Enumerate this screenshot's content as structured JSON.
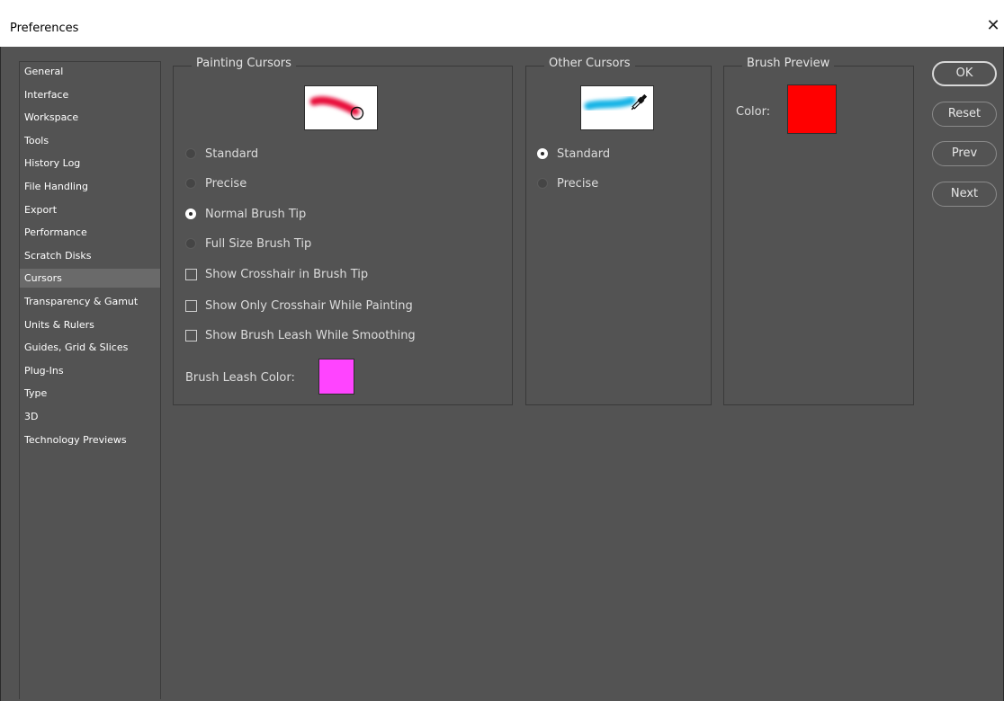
{
  "window": {
    "title": "Preferences",
    "close_glyph": "✕"
  },
  "sidebar": {
    "items": [
      {
        "label": "General"
      },
      {
        "label": "Interface"
      },
      {
        "label": "Workspace"
      },
      {
        "label": "Tools"
      },
      {
        "label": "History Log"
      },
      {
        "label": "File Handling"
      },
      {
        "label": "Export"
      },
      {
        "label": "Performance"
      },
      {
        "label": "Scratch Disks"
      },
      {
        "label": "Cursors",
        "selected": true
      },
      {
        "label": "Transparency & Gamut"
      },
      {
        "label": "Units & Rulers"
      },
      {
        "label": "Guides, Grid & Slices"
      },
      {
        "label": "Plug-Ins"
      },
      {
        "label": "Type"
      },
      {
        "label": "3D"
      },
      {
        "label": "Technology Previews"
      }
    ]
  },
  "painting_cursors": {
    "title": "Painting Cursors",
    "preview_icon": "brush-stroke-circle-cursor-icon",
    "stroke_color": "#e8103a",
    "options": [
      {
        "label": "Standard",
        "selected": false
      },
      {
        "label": "Precise",
        "selected": false
      },
      {
        "label": "Normal Brush Tip",
        "selected": true
      },
      {
        "label": "Full Size Brush Tip",
        "selected": false
      }
    ],
    "checkboxes": [
      {
        "label": "Show Crosshair in Brush Tip",
        "checked": false
      },
      {
        "label": "Show Only Crosshair While Painting",
        "checked": false
      },
      {
        "label": "Show Brush Leash While Smoothing",
        "checked": false
      }
    ],
    "leash_color_label": "Brush Leash Color:",
    "leash_color": "#ff44ff"
  },
  "other_cursors": {
    "title": "Other Cursors",
    "preview_icon": "eyedropper-cursor-icon",
    "stroke_color": "#14b4e6",
    "options": [
      {
        "label": "Standard",
        "selected": true
      },
      {
        "label": "Precise",
        "selected": false
      }
    ]
  },
  "brush_preview": {
    "title": "Brush Preview",
    "color_label": "Color:",
    "color": "#ff0000"
  },
  "buttons": {
    "ok": "OK",
    "reset": "Reset",
    "prev": "Prev",
    "next": "Next"
  }
}
